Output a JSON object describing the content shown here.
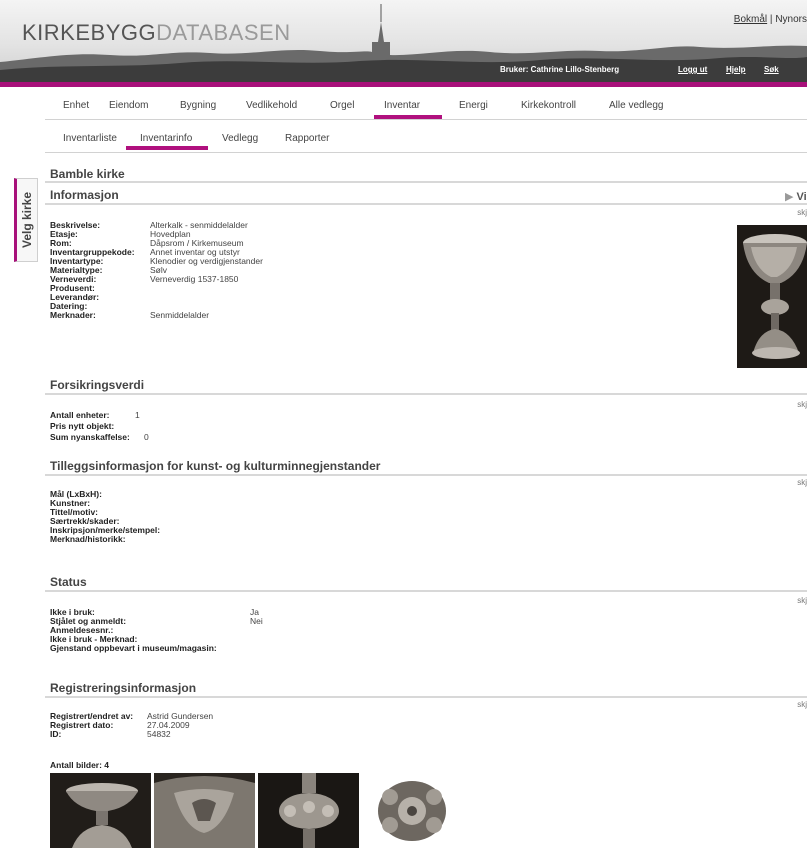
{
  "header": {
    "logo_part1": "KIRKEBYGG",
    "logo_part2": "DATABASEN",
    "lang_bokmal": "Bokmål",
    "lang_sep": "|",
    "lang_nynorsk": "Nynors",
    "user": "Bruker: Cathrine Lillo-Stenberg",
    "logout": "Logg ut",
    "help": "Hjelp",
    "search": "Søk"
  },
  "main_nav": [
    "Enhet",
    "Eiendom",
    "Bygning",
    "Vedlikehold",
    "Orgel",
    "Inventar",
    "Energi",
    "Kirkekontroll",
    "Alle vedlegg"
  ],
  "main_nav_active": "Inventar",
  "sub_nav": [
    "Inventarliste",
    "Inventarinfo",
    "Vedlegg",
    "Rapporter"
  ],
  "sub_nav_active": "Inventarinfo",
  "side_tab": "Velg kirke",
  "church_name": "Bamble kirke",
  "show_label": "Vi",
  "edit_label": "skj",
  "sections": {
    "info": {
      "title": "Informasjon",
      "rows": [
        {
          "label": "Beskrivelse:",
          "value": "Alterkalk - senmiddelalder"
        },
        {
          "label": "Etasje:",
          "value": "Hovedplan"
        },
        {
          "label": "Rom:",
          "value": "Dåpsrom / Kirkemuseum"
        },
        {
          "label": "Inventargruppekode:",
          "value": "Annet inventar og utstyr"
        },
        {
          "label": "Inventartype:",
          "value": "Klenodier og verdigjenstander"
        },
        {
          "label": "Materialtype:",
          "value": "Sølv"
        },
        {
          "label": "Verneverdi:",
          "value": "Verneverdig 1537-1850"
        },
        {
          "label": "Produsent:",
          "value": ""
        },
        {
          "label": "Leverandør:",
          "value": ""
        },
        {
          "label": "Datering:",
          "value": ""
        },
        {
          "label": "Merknader:",
          "value": "Senmiddelalder"
        }
      ]
    },
    "insurance": {
      "title": "Forsikringsverdi",
      "rows": [
        {
          "label": "Antall enheter:",
          "value": "1"
        },
        {
          "label": "Pris nytt objekt:",
          "value": ""
        },
        {
          "label": "Sum nyanskaffelse:",
          "value": "0"
        }
      ]
    },
    "art": {
      "title": "Tilleggsinformasjon for kunst- og kulturminnegjenstander",
      "rows": [
        {
          "label": "Mål (LxBxH):",
          "value": ""
        },
        {
          "label": "Kunstner:",
          "value": ""
        },
        {
          "label": "Tittel/motiv:",
          "value": ""
        },
        {
          "label": "Særtrekk/skader:",
          "value": ""
        },
        {
          "label": "Inskripsjon/merke/stempel:",
          "value": ""
        },
        {
          "label": "Merknad/historikk:",
          "value": ""
        }
      ]
    },
    "status": {
      "title": "Status",
      "rows": [
        {
          "label": "Ikke i bruk:",
          "value": "Ja"
        },
        {
          "label": "Stjålet og anmeldt:",
          "value": "Nei"
        },
        {
          "label": "Anmeldesesnr.:",
          "value": ""
        },
        {
          "label": "Ikke i bruk - Merknad:",
          "value": ""
        },
        {
          "label": "Gjenstand oppbevart i museum/magasin:",
          "value": ""
        }
      ]
    },
    "registration": {
      "title": "Registreringsinformasjon",
      "rows": [
        {
          "label": "Registrert/endret av:",
          "value": "Astrid Gundersen"
        },
        {
          "label": "Registrert dato:",
          "value": "27.04.2009"
        },
        {
          "label": "ID:",
          "value": "54832"
        }
      ]
    }
  },
  "images_count_label": "Antall bilder: 4"
}
